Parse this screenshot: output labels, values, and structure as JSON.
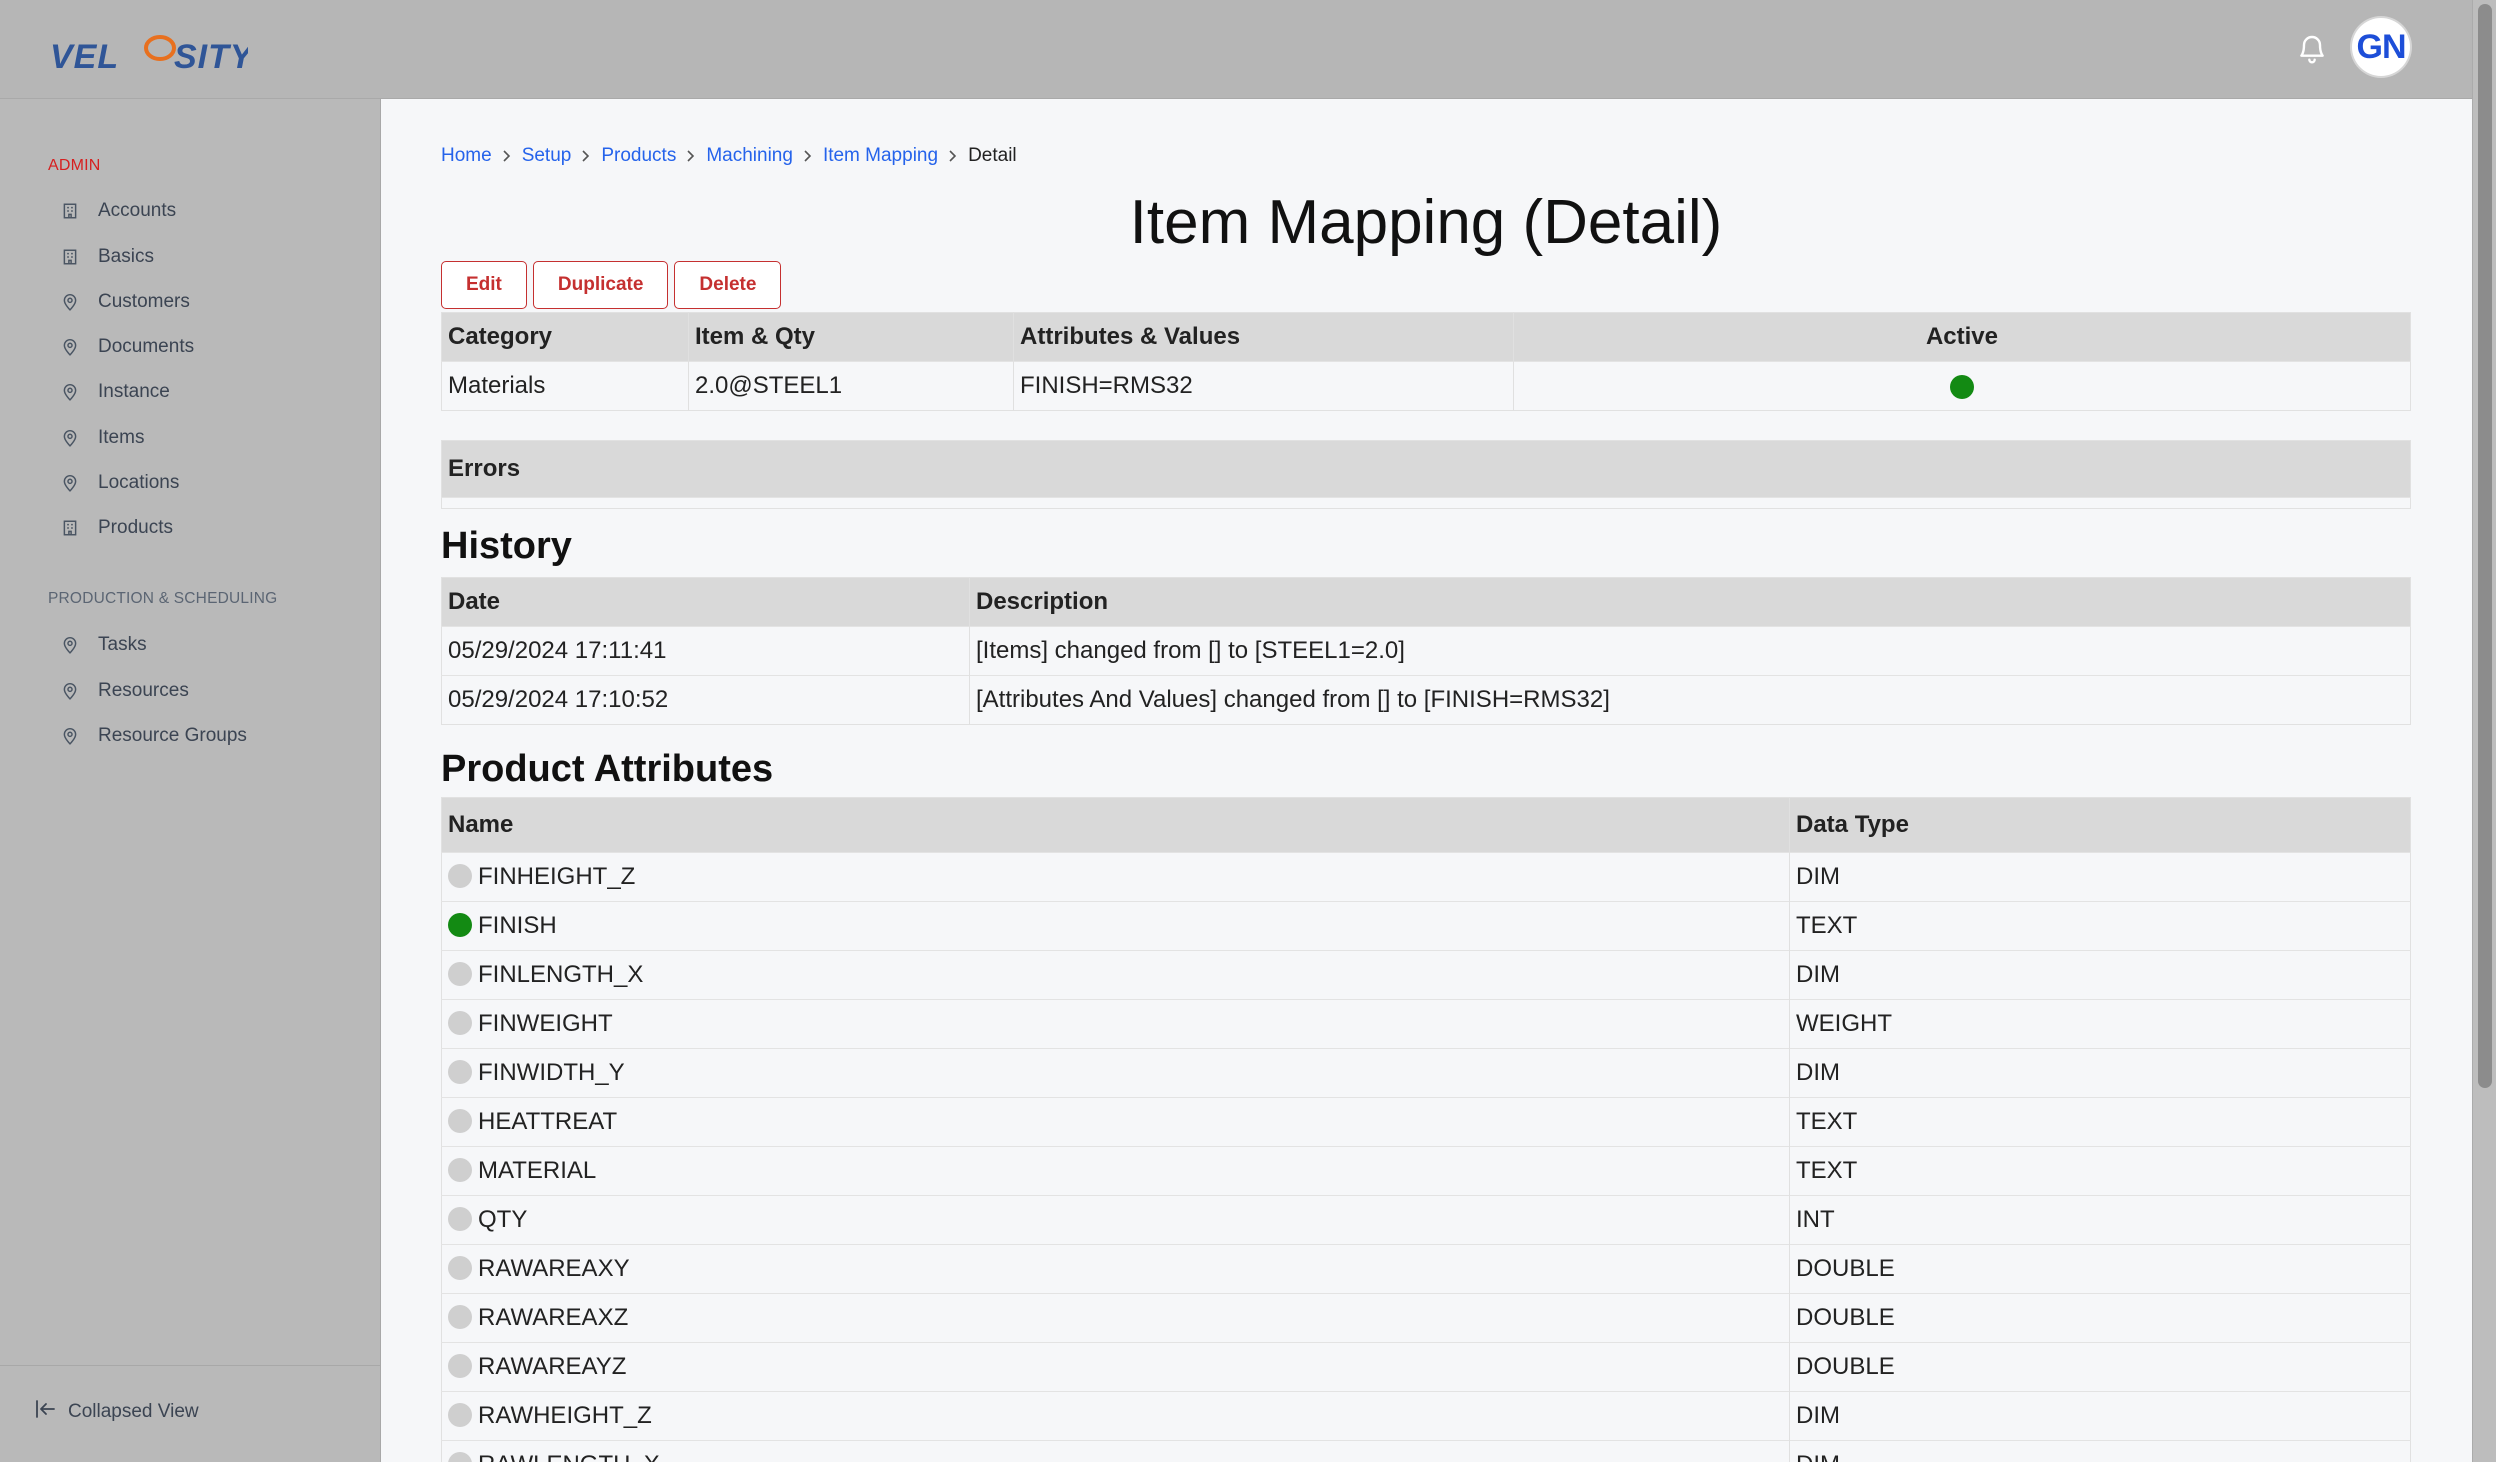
{
  "header": {
    "logo_text": "VELOSITY",
    "avatar_initials": "GN",
    "icons": {
      "notifications": "bell-icon"
    }
  },
  "sidebar": {
    "sections": [
      {
        "label": "ADMIN",
        "items": [
          {
            "label": "Accounts",
            "icon": "building-icon"
          },
          {
            "label": "Basics",
            "icon": "building-icon"
          },
          {
            "label": "Customers",
            "icon": "pin-icon"
          },
          {
            "label": "Documents",
            "icon": "pin-icon"
          },
          {
            "label": "Instance",
            "icon": "pin-icon"
          },
          {
            "label": "Items",
            "icon": "pin-icon"
          },
          {
            "label": "Locations",
            "icon": "pin-icon"
          },
          {
            "label": "Products",
            "icon": "building-icon"
          }
        ]
      },
      {
        "label": "PRODUCTION & SCHEDULING",
        "items": [
          {
            "label": "Tasks",
            "icon": "pin-icon"
          },
          {
            "label": "Resources",
            "icon": "pin-icon"
          },
          {
            "label": "Resource Groups",
            "icon": "pin-icon"
          }
        ]
      }
    ],
    "collapse_label": "Collapsed View"
  },
  "breadcrumb": {
    "links": [
      "Home",
      "Setup",
      "Products",
      "Machining",
      "Item Mapping"
    ],
    "current": "Detail"
  },
  "page": {
    "title": "Item Mapping (Detail)",
    "actions": {
      "edit": "Edit",
      "duplicate": "Duplicate",
      "delete": "Delete"
    }
  },
  "mapping_table": {
    "headers": {
      "category": "Category",
      "item_qty": "Item & Qty",
      "attributes": "Attributes & Values",
      "active": "Active"
    },
    "row": {
      "category": "Materials",
      "item_qty": "2.0@STEEL1",
      "attributes": "FINISH=RMS32",
      "active": true
    }
  },
  "errors": {
    "header": "Errors"
  },
  "history": {
    "title": "History",
    "headers": {
      "date": "Date",
      "description": "Description"
    },
    "rows": [
      {
        "date": "05/29/2024 17:11:41",
        "description": "[Items] changed from [] to [STEEL1=2.0]"
      },
      {
        "date": "05/29/2024 17:10:52",
        "description": "[Attributes And Values] changed from [] to [FINISH=RMS32]"
      }
    ]
  },
  "product_attributes": {
    "title": "Product Attributes",
    "headers": {
      "name": "Name",
      "data_type": "Data Type"
    },
    "rows": [
      {
        "name": "FINHEIGHT_Z",
        "type": "DIM",
        "selected": false
      },
      {
        "name": "FINISH",
        "type": "TEXT",
        "selected": true
      },
      {
        "name": "FINLENGTH_X",
        "type": "DIM",
        "selected": false
      },
      {
        "name": "FINWEIGHT",
        "type": "WEIGHT",
        "selected": false
      },
      {
        "name": "FINWIDTH_Y",
        "type": "DIM",
        "selected": false
      },
      {
        "name": "HEATTREAT",
        "type": "TEXT",
        "selected": false
      },
      {
        "name": "MATERIAL",
        "type": "TEXT",
        "selected": false
      },
      {
        "name": "QTY",
        "type": "INT",
        "selected": false
      },
      {
        "name": "RAWAREAXY",
        "type": "DOUBLE",
        "selected": false
      },
      {
        "name": "RAWAREAXZ",
        "type": "DOUBLE",
        "selected": false
      },
      {
        "name": "RAWAREAYZ",
        "type": "DOUBLE",
        "selected": false
      },
      {
        "name": "RAWHEIGHT_Z",
        "type": "DIM",
        "selected": false
      },
      {
        "name": "RAWLENGTH_X",
        "type": "DIM",
        "selected": false
      }
    ]
  },
  "colors": {
    "accent": "#2563eb",
    "danger": "#c53030",
    "active_dot": "#138a13",
    "admin_label": "#d62020"
  }
}
